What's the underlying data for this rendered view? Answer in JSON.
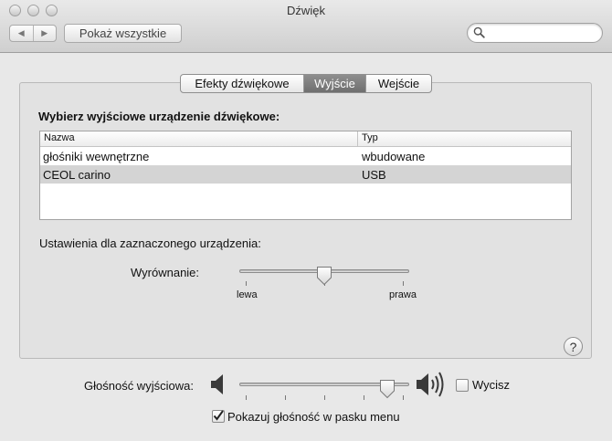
{
  "window": {
    "title": "Dźwięk"
  },
  "toolbar": {
    "back_glyph": "◀",
    "forward_glyph": "▶",
    "show_all_label": "Pokaż wszystkie",
    "search": {
      "value": "",
      "placeholder": ""
    }
  },
  "tabs": [
    {
      "label": "Efekty dźwiękowe",
      "selected": false
    },
    {
      "label": "Wyjście",
      "selected": true
    },
    {
      "label": "Wejście",
      "selected": false
    }
  ],
  "output": {
    "heading": "Wybierz wyjściowe urządzenie dźwiękowe:",
    "columns": [
      "Nazwa",
      "Typ"
    ],
    "rows": [
      {
        "name": "głośniki wewnętrzne",
        "type": "wbudowane"
      },
      {
        "name": "CEOL carino",
        "type": "USB",
        "selected": true
      }
    ],
    "settings_label": "Ustawienia dla zaznaczonego urządzenia:",
    "balance": {
      "label": "Wyrównanie:",
      "left_label": "lewa",
      "right_label": "prawa",
      "value": 0.5
    }
  },
  "help_glyph": "?",
  "volume": {
    "label": "Głośność wyjściowa:",
    "value": 0.9,
    "mute_label": "Wycisz",
    "muted": false
  },
  "show_in_menu": {
    "label": "Pokazuj głośność w pasku menu",
    "checked": true
  }
}
